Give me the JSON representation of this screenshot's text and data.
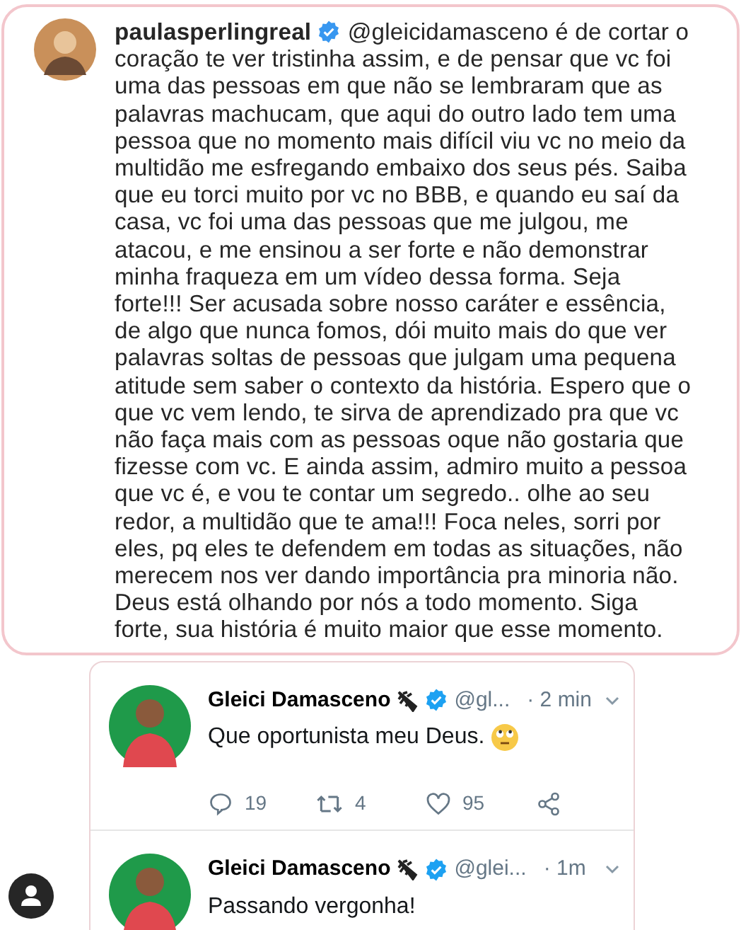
{
  "comment": {
    "username": "paulasperlingreal",
    "verified": true,
    "mention": "@gleicidamasceno",
    "text": "é de cortar o coração te ver tristinha assim, e de pensar que vc foi uma das pessoas em que não se lembraram que as palavras machucam, que aqui do outro lado tem uma pessoa que no momento mais difícil viu vc no meio da multidão me esfregando embaixo dos seus pés. Saiba que eu torci muito por vc no BBB, e quando eu saí da casa, vc foi uma das pessoas que me julgou, me atacou, e me ensinou a ser forte e não demonstrar minha fraqueza em um vídeo dessa forma. Seja forte!!! Ser acusada sobre nosso caráter e essência, de algo que nunca fomos, dói muito mais do que ver palavras soltas de pessoas que julgam uma pequena atitude sem saber o contexto da história. Espero que o que vc vem lendo, te sirva de aprendizado pra que vc não faça mais com as pessoas oque não gostaria que fizesse com vc. E ainda assim, admiro muito a pessoa que vc é, e vou te contar um segredo.. olhe ao seu redor, a multidão que te ama!!! Foca neles, sorri por eles, pq eles te defendem em todas as situações, não merecem nos ver dando importância pra minoria não. Deus está olhando por nós a todo momento. Siga forte, sua história é muito maior que esse momento."
  },
  "tweets": [
    {
      "name": "Gleici Damasceno",
      "verified": true,
      "handle": "@gl...",
      "time": "· 2 min",
      "text": "Que oportunista meu Deus.",
      "has_emoji": true,
      "actions": {
        "replies": "19",
        "retweets": "4",
        "likes": "95"
      }
    },
    {
      "name": "Gleici Damasceno",
      "verified": true,
      "handle": "@glei...",
      "time": "· 1m",
      "text": "Passando vergonha!"
    }
  ]
}
